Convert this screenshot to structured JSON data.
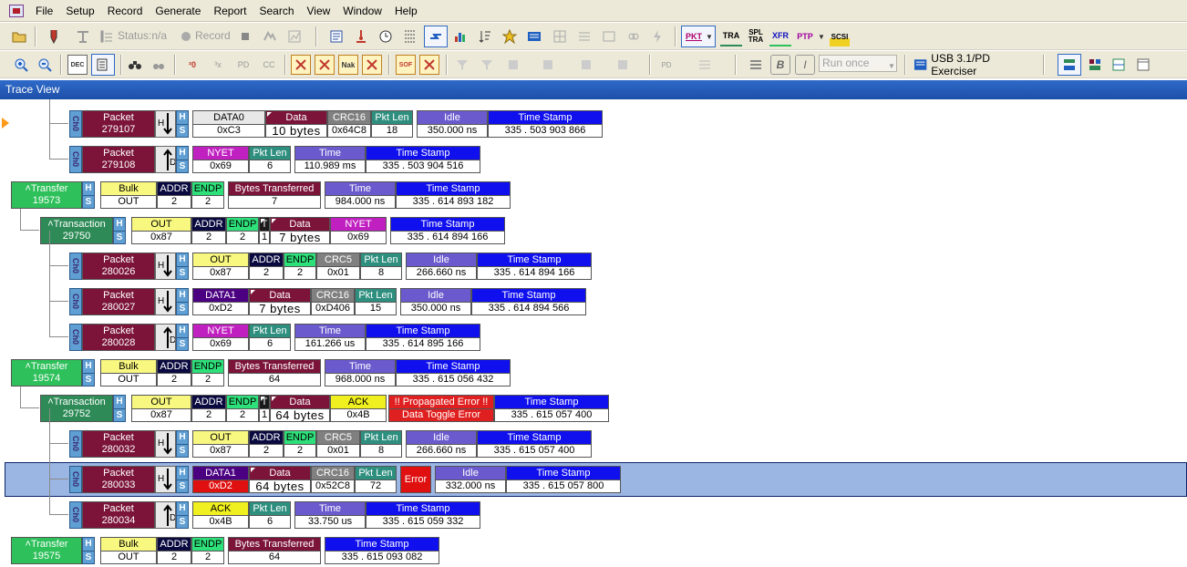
{
  "menu": [
    "File",
    "Setup",
    "Record",
    "Generate",
    "Report",
    "Search",
    "View",
    "Window",
    "Help"
  ],
  "toolbar": {
    "status": "Status:n/a",
    "record": "Record",
    "protocols": [
      "PKT",
      "TRA",
      "SPL TRA",
      "XFR",
      "PTP",
      "SCSI"
    ],
    "run_mode": "Run once",
    "exerciser": "USB 3.1/PD Exerciser",
    "format_labels": {
      "dec": "DEC"
    }
  },
  "window_title": "Trace View",
  "colors": {
    "packet": "#7b1438",
    "transfer": "#2ec05a",
    "transaction": "#2e8b57",
    "idle": "#6a5acd",
    "timestamp": "#1010ee",
    "error": "#e01010",
    "selection": "#9cb6e4"
  },
  "icons": [
    "open-icon",
    "probe-icon",
    "trigger-icon",
    "status-icon",
    "record-icon",
    "stop-icon",
    "view-icon",
    "chart-icon",
    "packet-view-icon",
    "transfer-view-icon",
    "split-transaction-icon",
    "xfer-view-icon",
    "ptp-view-icon",
    "scsi-view-icon",
    "zoom-in-icon",
    "zoom-out-icon",
    "binoculars-icon",
    "search-icon",
    "filter-icon",
    "hide-icon",
    "run-icon",
    "layout-icon"
  ],
  "rows": [
    {
      "kind": "packet",
      "ch": "Ch0",
      "num": "279107",
      "dir": "H",
      "fields": [
        [
          "DATA0",
          "0xC3"
        ],
        [
          "Data",
          "10 bytes"
        ],
        [
          "CRC16",
          "0x64C8"
        ],
        [
          "Pkt Len",
          "18"
        ],
        [
          "Idle",
          "350.000 ns"
        ],
        [
          "Time Stamp",
          "335 . 503 903 866"
        ]
      ]
    },
    {
      "kind": "packet",
      "ch": "Ch0",
      "num": "279108",
      "dir": "D",
      "fields": [
        [
          "NYET",
          "0x69"
        ],
        [
          "Pkt Len",
          "6"
        ],
        [
          "Time",
          "110.989 ms"
        ],
        [
          "Time Stamp",
          "335 . 503 904 516"
        ]
      ]
    },
    {
      "kind": "transfer",
      "num": "19573",
      "fields": [
        [
          "Bulk",
          "OUT"
        ],
        [
          "ADDR",
          "2"
        ],
        [
          "ENDP",
          "2"
        ],
        [
          "Bytes Transferred",
          "7"
        ],
        [
          "Time",
          "984.000 ns"
        ],
        [
          "Time Stamp",
          "335 . 614 893 182"
        ]
      ]
    },
    {
      "kind": "transaction",
      "num": "29750",
      "fields": [
        [
          "OUT",
          "0x87"
        ],
        [
          "ADDR",
          "2"
        ],
        [
          "ENDP",
          "2"
        ],
        [
          "T",
          "1"
        ],
        [
          "Data",
          "7 bytes"
        ],
        [
          "NYET",
          "0x69"
        ],
        [
          "Time Stamp",
          "335 . 614 894 166"
        ]
      ]
    },
    {
      "kind": "packet",
      "ch": "Ch0",
      "num": "280026",
      "dir": "H",
      "fields": [
        [
          "OUT",
          "0x87"
        ],
        [
          "ADDR",
          "2"
        ],
        [
          "ENDP",
          "2"
        ],
        [
          "CRC5",
          "0x01"
        ],
        [
          "Pkt Len",
          "8"
        ],
        [
          "Idle",
          "266.660 ns"
        ],
        [
          "Time Stamp",
          "335 . 614 894 166"
        ]
      ]
    },
    {
      "kind": "packet",
      "ch": "Ch0",
      "num": "280027",
      "dir": "H",
      "fields": [
        [
          "DATA1",
          "0xD2"
        ],
        [
          "Data",
          "7 bytes"
        ],
        [
          "CRC16",
          "0xD406"
        ],
        [
          "Pkt Len",
          "15"
        ],
        [
          "Idle",
          "350.000 ns"
        ],
        [
          "Time Stamp",
          "335 . 614 894 566"
        ]
      ]
    },
    {
      "kind": "packet",
      "ch": "Ch0",
      "num": "280028",
      "dir": "D",
      "fields": [
        [
          "NYET",
          "0x69"
        ],
        [
          "Pkt Len",
          "6"
        ],
        [
          "Time",
          "161.266 us"
        ],
        [
          "Time Stamp",
          "335 . 614 895 166"
        ]
      ]
    },
    {
      "kind": "transfer",
      "num": "19574",
      "fields": [
        [
          "Bulk",
          "OUT"
        ],
        [
          "ADDR",
          "2"
        ],
        [
          "ENDP",
          "2"
        ],
        [
          "Bytes Transferred",
          "64"
        ],
        [
          "Time",
          "968.000 ns"
        ],
        [
          "Time Stamp",
          "335 . 615 056 432"
        ]
      ]
    },
    {
      "kind": "transaction",
      "num": "29752",
      "fields": [
        [
          "OUT",
          "0x87"
        ],
        [
          "ADDR",
          "2"
        ],
        [
          "ENDP",
          "2"
        ],
        [
          "T",
          "1"
        ],
        [
          "Data",
          "64 bytes"
        ],
        [
          "ACK",
          "0x4B"
        ],
        [
          "!! Propagated Error !!",
          "Data Toggle Error"
        ],
        [
          "Time Stamp",
          "335 . 615 057 400"
        ]
      ]
    },
    {
      "kind": "packet",
      "ch": "Ch0",
      "num": "280032",
      "dir": "H",
      "fields": [
        [
          "OUT",
          "0x87"
        ],
        [
          "ADDR",
          "2"
        ],
        [
          "ENDP",
          "2"
        ],
        [
          "CRC5",
          "0x01"
        ],
        [
          "Pkt Len",
          "8"
        ],
        [
          "Idle",
          "266.660 ns"
        ],
        [
          "Time Stamp",
          "335 . 615 057 400"
        ]
      ]
    },
    {
      "kind": "packet",
      "ch": "Ch0",
      "num": "280033",
      "dir": "H",
      "selected": true,
      "fields": [
        [
          "DATA1",
          "0xD2"
        ],
        [
          "Data",
          "64 bytes"
        ],
        [
          "CRC16",
          "0x52C8"
        ],
        [
          "Pkt Len",
          "72"
        ],
        [
          "Error",
          ""
        ],
        [
          "Idle",
          "332.000 ns"
        ],
        [
          "Time Stamp",
          "335 . 615 057 800"
        ]
      ]
    },
    {
      "kind": "packet",
      "ch": "Ch0",
      "num": "280034",
      "dir": "D",
      "fields": [
        [
          "ACK",
          "0x4B"
        ],
        [
          "Pkt Len",
          "6"
        ],
        [
          "Time",
          "33.750 us"
        ],
        [
          "Time Stamp",
          "335 . 615 059 332"
        ]
      ]
    },
    {
      "kind": "transfer",
      "num": "19575",
      "fields": [
        [
          "Bulk",
          "OUT"
        ],
        [
          "ADDR",
          "2"
        ],
        [
          "ENDP",
          "2"
        ],
        [
          "Bytes Transferred",
          "64"
        ],
        [
          "Time Stamp",
          "335 . 615 093 082"
        ]
      ]
    }
  ],
  "labels": {
    "packet": "Packet",
    "transfer": "Transfer",
    "transaction": "Transaction",
    "h": "H",
    "s": "S",
    "d": "D"
  }
}
